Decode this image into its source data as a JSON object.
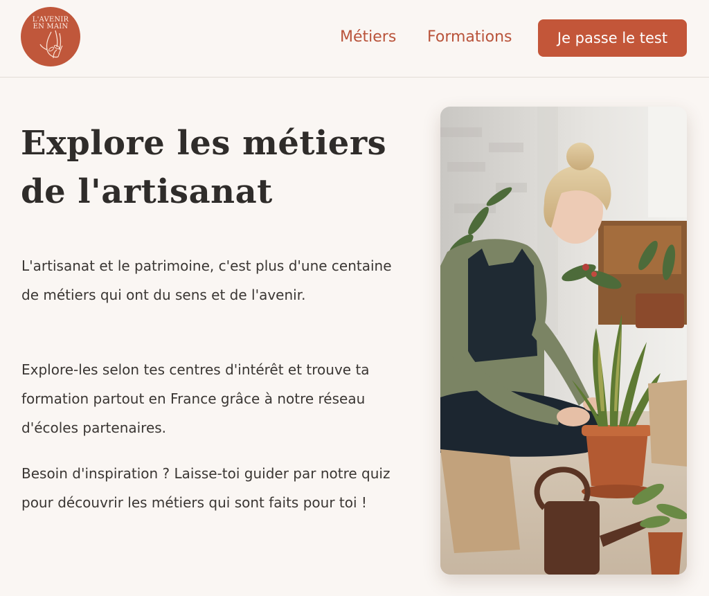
{
  "header": {
    "logo": {
      "line1": "L'AVENIR",
      "line2": "EN MAIN",
      "color": "#c0573b"
    },
    "nav": {
      "metiers": "Métiers",
      "formations": "Formations"
    },
    "cta": "Je passe le test"
  },
  "hero": {
    "title": "Explore les métiers de l'artisanat",
    "paragraphs": [
      "L'artisanat et le patrimoine, c'est plus d'une centaine de métiers qui ont du sens et de l'avenir.",
      "Explore-les selon tes centres d'intérêt et trouve ta formation partout en France grâce à notre réseau d'écoles partenaires.",
      "Besoin d'inspiration ? Laisse-toi guider par notre quiz pour découvrir les métiers qui sont faits pour toi !"
    ],
    "image": {
      "subject": "woman-repotting-plants-photo"
    }
  },
  "colors": {
    "accent": "#c35639",
    "nav_link": "#b9533a",
    "background": "#faf6f3",
    "heading": "#2f2c2a",
    "text": "#3a3633"
  }
}
